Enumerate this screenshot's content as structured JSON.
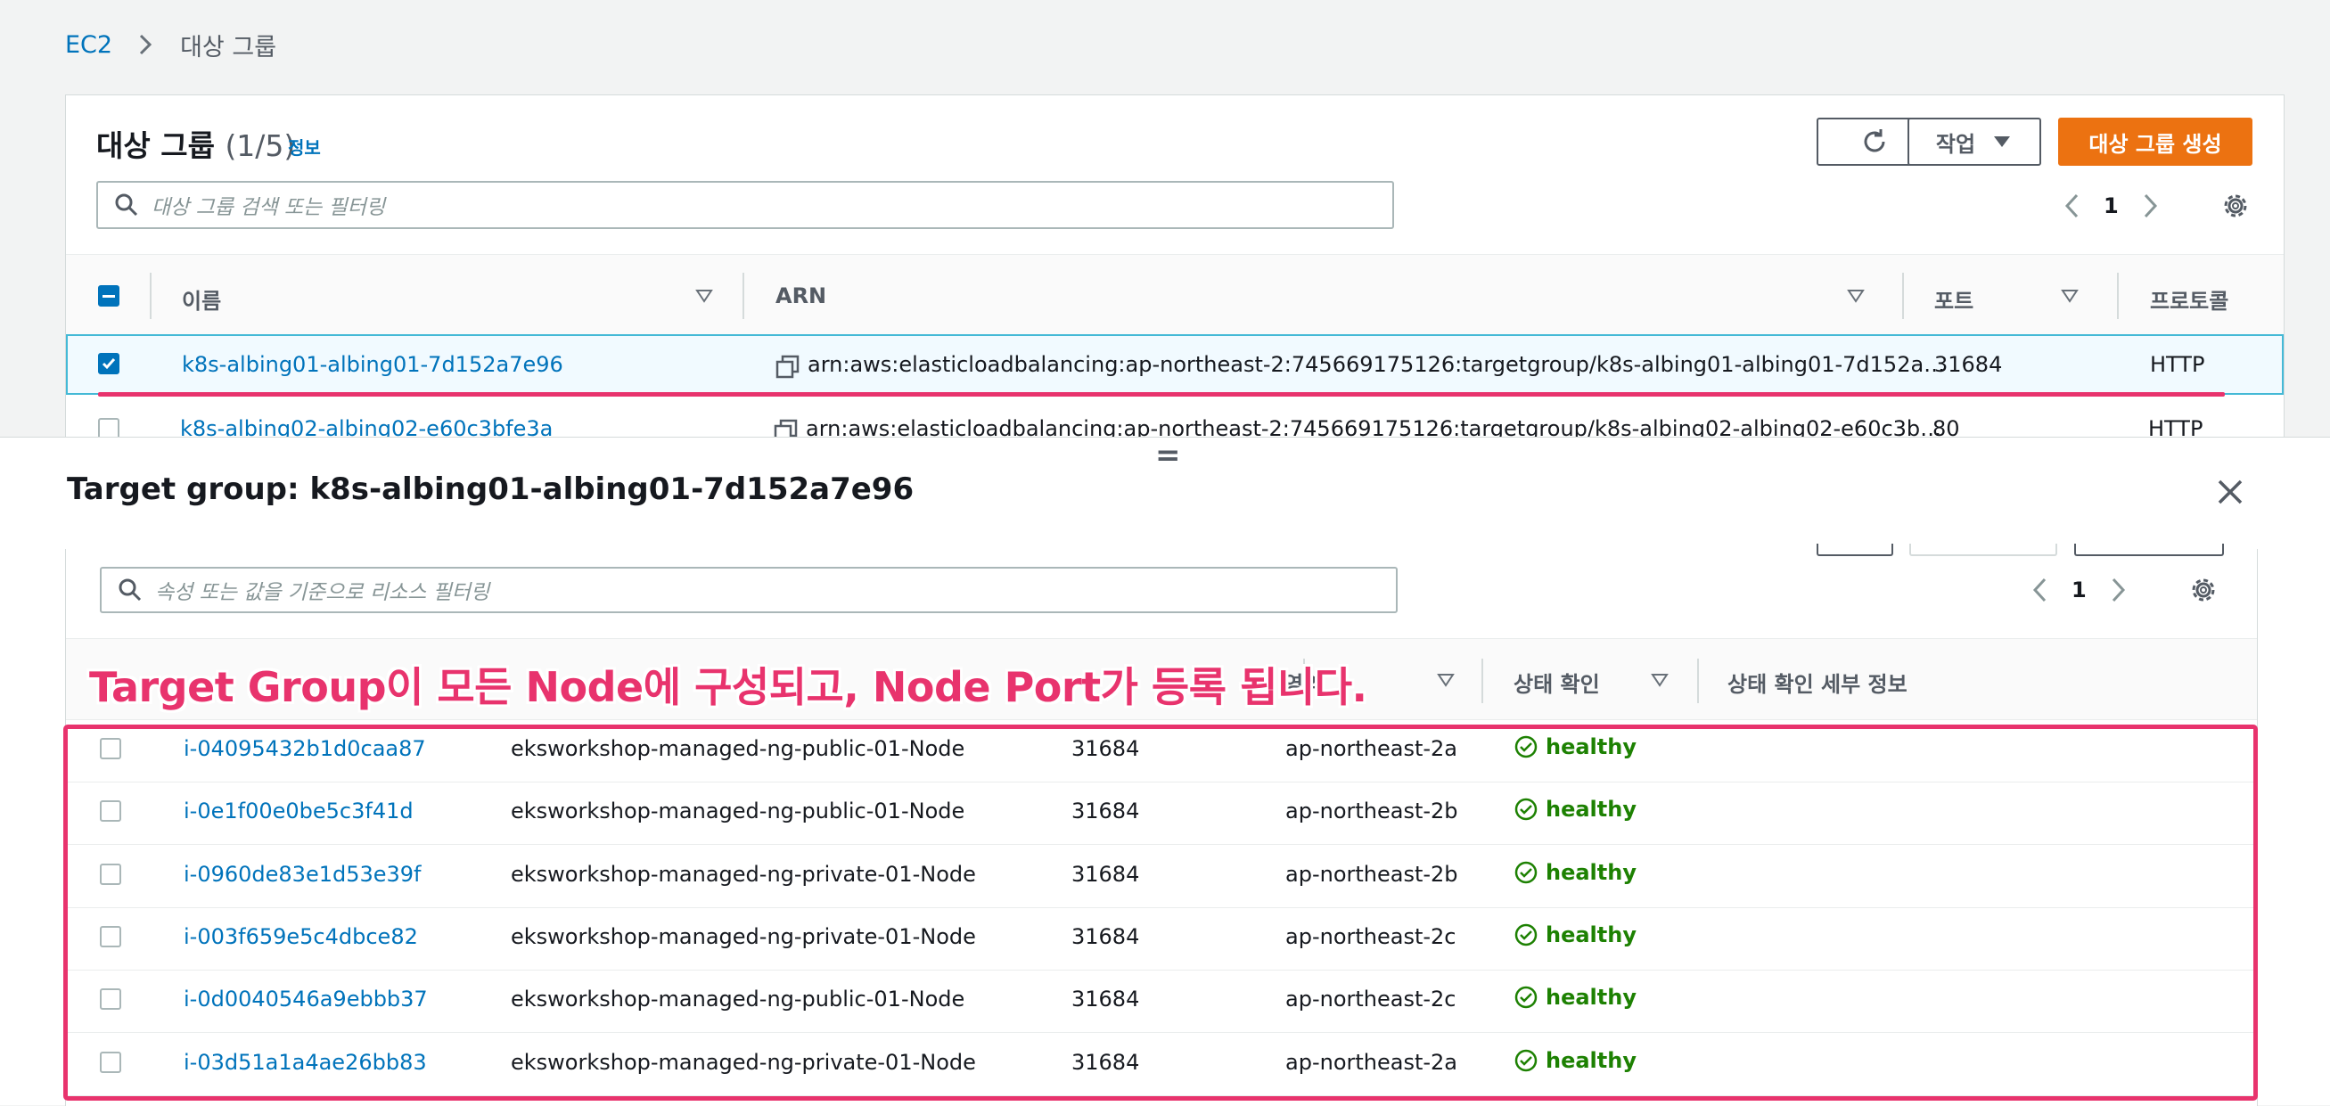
{
  "breadcrumb": {
    "root": "EC2",
    "current": "대상 그룹"
  },
  "target_groups": {
    "title": "대상 그룹",
    "count": "(1/5)",
    "info_link": "정보",
    "actions_label": "작업",
    "create_label": "대상 그룹 생성",
    "search_placeholder": "대상 그룹 검색 또는 필터링",
    "page": "1",
    "columns": [
      "이름",
      "ARN",
      "포트",
      "프로토콜"
    ],
    "rows": [
      {
        "name": "k8s-albing01-albing01-7d152a7e96",
        "arn": "arn:aws:elasticloadbalancing:ap-northeast-2:745669175126:targetgroup/k8s-albing01-albing01-7d152a…",
        "port": "31684",
        "protocol": "HTTP",
        "selected": true
      },
      {
        "name": "k8s-albing02-albing02-e60c3bfe3a",
        "arn": "arn:aws:elasticloadbalancing:ap-northeast-2:745669175126:targetgroup/k8s-albing02-albing02-e60c3b…",
        "port": "80",
        "protocol": "HTTP",
        "selected": false
      }
    ]
  },
  "split_panel": {
    "title": "Target group: k8s-albing01-albing01-7d152a7e96",
    "handle": "=",
    "search_placeholder": "속성 또는 값을 기준으로 리소스 필터링",
    "page": "1",
    "columns": {
      "zone": "영역",
      "health": "상태 확인",
      "health_details": "상태 확인 세부 정보"
    },
    "targets": [
      {
        "id": "i-04095432b1d0caa87",
        "name": "eksworkshop-managed-ng-public-01-Node",
        "port": "31684",
        "zone": "ap-northeast-2a",
        "status": "healthy"
      },
      {
        "id": "i-0e1f00e0be5c3f41d",
        "name": "eksworkshop-managed-ng-public-01-Node",
        "port": "31684",
        "zone": "ap-northeast-2b",
        "status": "healthy"
      },
      {
        "id": "i-0960de83e1d53e39f",
        "name": "eksworkshop-managed-ng-private-01-Node",
        "port": "31684",
        "zone": "ap-northeast-2b",
        "status": "healthy"
      },
      {
        "id": "i-003f659e5c4dbce82",
        "name": "eksworkshop-managed-ng-private-01-Node",
        "port": "31684",
        "zone": "ap-northeast-2c",
        "status": "healthy"
      },
      {
        "id": "i-0d0040546a9ebbb37",
        "name": "eksworkshop-managed-ng-public-01-Node",
        "port": "31684",
        "zone": "ap-northeast-2c",
        "status": "healthy"
      },
      {
        "id": "i-03d51a1a4ae26bb83",
        "name": "eksworkshop-managed-ng-private-01-Node",
        "port": "31684",
        "zone": "ap-northeast-2a",
        "status": "healthy"
      }
    ]
  },
  "annotation": "Target Group이 모든 Node에 구성되고, Node Port가 등록 됩니다.",
  "colors": {
    "link": "#0073bb",
    "primary": "#ec7211",
    "healthy": "#1d8102",
    "highlight": "#e8336d"
  },
  "icons": [
    "chevron-right-icon",
    "refresh-icon",
    "caret-down-icon",
    "search-icon",
    "chevron-left-icon",
    "gear-icon",
    "sort-icon",
    "copy-icon",
    "close-icon",
    "check-circle-icon"
  ]
}
